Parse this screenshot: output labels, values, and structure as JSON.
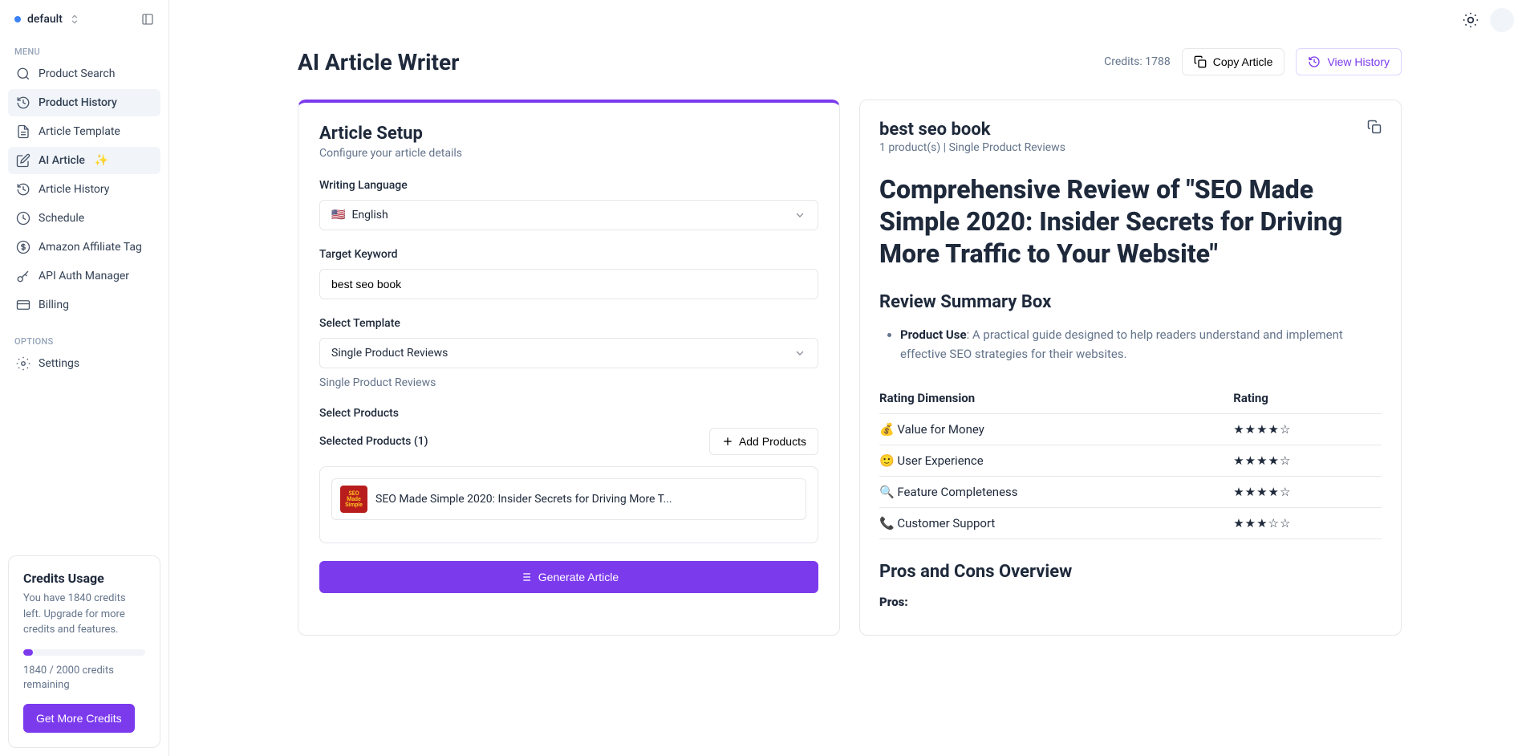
{
  "workspace": {
    "name": "default"
  },
  "sidebar": {
    "menu_label": "MENU",
    "options_label": "OPTIONS",
    "items": [
      {
        "label": "Product Search",
        "icon": "search"
      },
      {
        "label": "Product History",
        "icon": "history",
        "active": true
      },
      {
        "label": "Article Template",
        "icon": "file"
      },
      {
        "label": "AI Article",
        "icon": "edit",
        "sparkle": true,
        "active": true
      },
      {
        "label": "Article History",
        "icon": "history"
      },
      {
        "label": "Schedule",
        "icon": "clock"
      },
      {
        "label": "Amazon Affiliate Tag",
        "icon": "dollar"
      },
      {
        "label": "API Auth Manager",
        "icon": "key"
      },
      {
        "label": "Billing",
        "icon": "card"
      }
    ],
    "options": [
      {
        "label": "Settings",
        "icon": "gear"
      }
    ]
  },
  "credits_card": {
    "title": "Credits Usage",
    "description": "You have 1840 credits left. Upgrade for more credits and features.",
    "remaining_text": "1840 / 2000 credits remaining",
    "button": "Get More Credits"
  },
  "page": {
    "title": "AI Article Writer",
    "credits_label": "Credits: 1788",
    "copy_article": "Copy Article",
    "view_history": "View History"
  },
  "setup": {
    "title": "Article Setup",
    "subtitle": "Configure your article details",
    "language_label": "Writing Language",
    "language_value": "English",
    "language_flag": "🇺🇸",
    "keyword_label": "Target Keyword",
    "keyword_value": "best seo book",
    "template_label": "Select Template",
    "template_value": "Single Product Reviews",
    "template_hint": "Single Product Reviews",
    "products_label": "Select Products",
    "selected_label": "Selected Products (1)",
    "add_products": "Add Products",
    "product_name": "SEO Made Simple 2020: Insider Secrets for Driving More T...",
    "generate": "Generate Article"
  },
  "preview": {
    "keyword": "best seo book",
    "meta": "1 product(s) | Single Product Reviews",
    "article_title": "Comprehensive Review of \"SEO Made Simple 2020: Insider Secrets for Driving More Traffic to Your Website\"",
    "review_summary_heading": "Review Summary Box",
    "summary_items": [
      {
        "label": "Product Use",
        "text": ": A practical guide designed to help readers understand and implement effective SEO strategies for their websites."
      }
    ],
    "rating_headers": {
      "dimension": "Rating Dimension",
      "rating": "Rating"
    },
    "ratings": [
      {
        "emoji": "💰",
        "label": "Value for Money",
        "stars": 4
      },
      {
        "emoji": "🙂",
        "label": "User Experience",
        "stars": 4
      },
      {
        "emoji": "🔍",
        "label": "Feature Completeness",
        "stars": 4
      },
      {
        "emoji": "📞",
        "label": "Customer Support",
        "stars": 3
      }
    ],
    "pros_cons_heading": "Pros and Cons Overview",
    "pros_label": "Pros:"
  }
}
